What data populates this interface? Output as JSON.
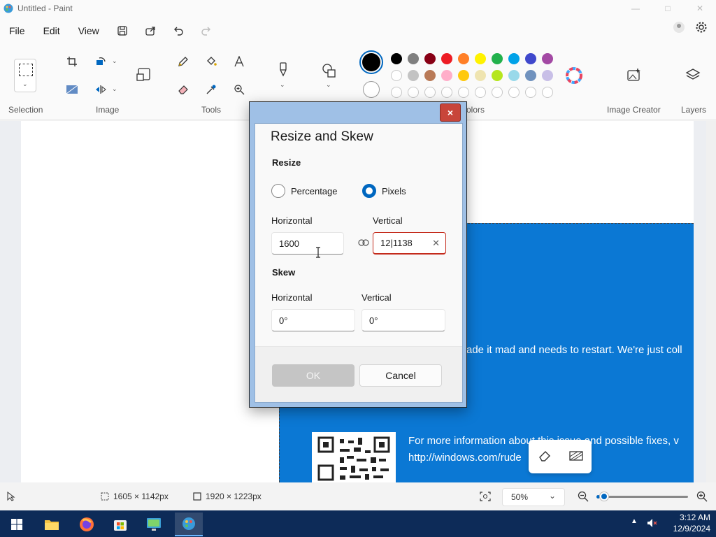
{
  "window": {
    "title": "Untitled - Paint"
  },
  "menu": {
    "file": "File",
    "edit": "Edit",
    "view": "View"
  },
  "ribbon": {
    "selection_label": "Selection",
    "image_label": "Image",
    "tools_label": "Tools",
    "colors_label": "olors",
    "image_creator_label": "Image Creator",
    "layers_label": "Layers",
    "primary_color": "#000000",
    "palette_row1": [
      "#000000",
      "#7f7f7f",
      "#880015",
      "#ed1c24",
      "#ff7f27",
      "#fff200",
      "#22b14c",
      "#00a2e8",
      "#3f48cc",
      "#a349a4"
    ],
    "palette_row2": [
      "#ffffff",
      "#c3c3c3",
      "#b97a57",
      "#ffaec9",
      "#ffc90e",
      "#efe4b0",
      "#b5e61d",
      "#99d9ea",
      "#7092be",
      "#c8bfe7"
    ]
  },
  "canvas": {
    "bsod_line1": "ade it mad and needs to restart. We're just coll",
    "bsod_line2": "For more information about this issue and possible fixes, v",
    "bsod_line3": "http://windows.com/rude"
  },
  "dialog": {
    "title": "Resize and Skew",
    "resize_heading": "Resize",
    "percentage_label": "Percentage",
    "pixels_label": "Pixels",
    "horizontal_label": "Horizontal",
    "vertical_label": "Vertical",
    "horizontal_value": "1600",
    "vertical_value": "12|1138",
    "skew_heading": "Skew",
    "skew_horizontal_label": "Horizontal",
    "skew_vertical_label": "Vertical",
    "skew_horizontal_value": "0°",
    "skew_vertical_value": "0°",
    "ok_label": "OK",
    "cancel_label": "Cancel",
    "close_glyph": "×"
  },
  "status": {
    "selection_size": "1605 × 1142px",
    "canvas_size": "1920 × 1223px",
    "zoom": "50%",
    "zoom_level": 0.06
  },
  "taskbar": {
    "time": "3:12 AM",
    "date": "12/9/2024"
  }
}
